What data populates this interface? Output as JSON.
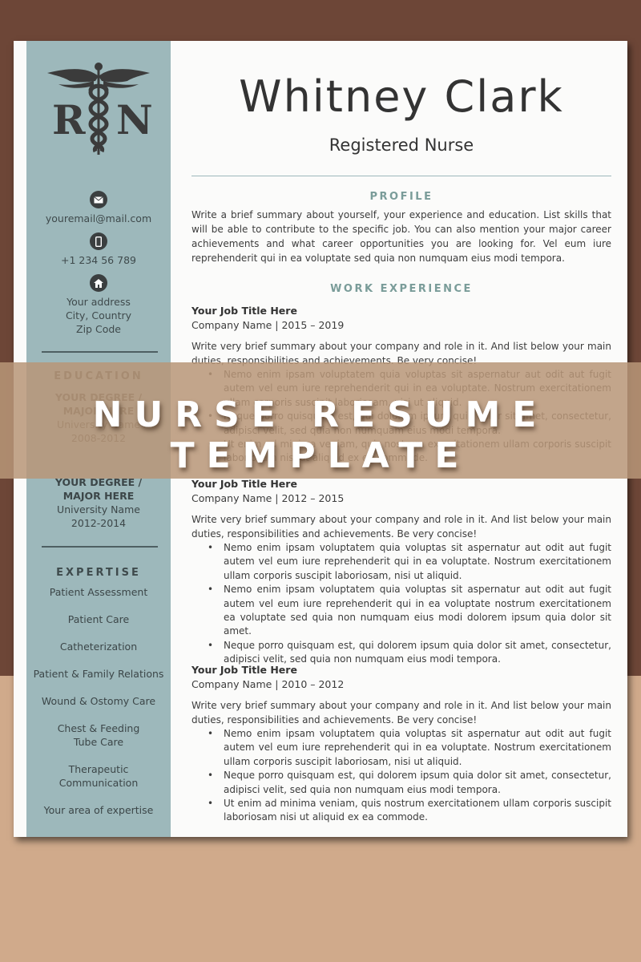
{
  "sidebar": {
    "logo_letters": [
      "R",
      "N"
    ],
    "contact": [
      {
        "icon": "envelope-icon",
        "lines": [
          "youremail@mail.com"
        ]
      },
      {
        "icon": "phone-icon",
        "lines": [
          "+1 234 56 789"
        ]
      },
      {
        "icon": "home-icon",
        "lines": [
          "Your address",
          "City, Country",
          "Zip Code"
        ]
      }
    ],
    "education": {
      "heading": "EDUCATION",
      "items": [
        {
          "degree": [
            "YOUR DEGREE /",
            "MAJOR HERE"
          ],
          "school": "University Name",
          "years": "2008-2012"
        },
        {
          "degree": [
            "YOUR DEGREE /",
            "MAJOR HERE"
          ],
          "school": "University Name",
          "years": "2012-2014"
        }
      ]
    },
    "expertise": {
      "heading": "EXPERTISE",
      "items": [
        "Patient Assessment",
        "Patient Care",
        "Catheterization",
        "Patient & Family Relations",
        "Wound & Ostomy Care",
        "Chest & Feeding Tube Care",
        "Therapeutic Communication",
        "Your area of expertise"
      ]
    }
  },
  "header": {
    "name": "Whitney Clark",
    "role": "Registered Nurse"
  },
  "profile": {
    "heading": "PROFILE",
    "text": "Write a brief summary about yourself, your experience and education. List skills that will be able to contribute to the specific job. You can also mention your major career achievements and what career opportunities you are looking for. Vel eum iure reprehenderit qui in ea voluptate sed quia non numquam eius modi tempora."
  },
  "work": {
    "heading": "WORK EXPERIENCE",
    "jobs": [
      {
        "title": "Your Job Title Here",
        "company": "Company Name | 2015 – 2019",
        "summary": "Write very brief summary about your company and role in it. And list below your main duties, responsibilities and achievements. Be very concise!",
        "bullets": [
          "Nemo enim ipsam voluptatem quia voluptas sit aspernatur aut odit aut fugit autem vel eum iure reprehenderit qui in ea voluptate. Nostrum exercitationem ullam corporis suscipit laboriosam, nisi ut aliquid.",
          "Neque porro quisquam est, qui dolorem ipsum quia dolor sit amet, consectetur, adipisci velit, sed quia non numquam eius modi tempora.",
          "Ut enim ad minima veniam, quis nostrum exercitationem ullam corporis suscipit laboriosam nisi ut aliquid ex ea commode."
        ]
      },
      {
        "title": "Your Job Title Here",
        "company": "Company Name | 2012 – 2015",
        "summary": "Write very brief summary about your company and role in it. And list below your main duties, responsibilities and achievements. Be very concise!",
        "bullets": [
          "Nemo enim ipsam voluptatem quia voluptas sit aspernatur aut odit aut fugit autem vel eum iure reprehenderit qui in ea voluptate. Nostrum exercitationem ullam corporis suscipit laboriosam, nisi ut aliquid.",
          "Nemo enim ipsam voluptatem quia voluptas sit aspernatur aut odit aut fugit autem vel eum iure reprehenderit qui in ea voluptate nostrum exercitationem ea voluptate sed quia non numquam eius modi dolorem ipsum quia dolor sit amet.",
          "Neque porro quisquam est, qui dolorem ipsum quia dolor sit amet, consectetur, adipisci velit, sed quia non numquam eius modi tempora."
        ]
      },
      {
        "title": "Your Job Title Here",
        "company": "Company Name | 2010 – 2012",
        "summary": "Write very brief summary about your company and role in it. And list below your main duties, responsibilities and achievements. Be very concise!",
        "bullets": [
          "Nemo enim ipsam voluptatem quia voluptas sit aspernatur aut odit aut fugit autem vel eum iure reprehenderit qui in ea voluptate. Nostrum exercitationem ullam corporis suscipit laboriosam, nisi ut aliquid.",
          "Neque porro quisquam est, qui dolorem ipsum quia dolor sit amet, consectetur, adipisci velit, sed quia non numquam eius modi tempora.",
          "Ut enim ad minima veniam, quis nostrum exercitationem ullam corporis suscipit laboriosam nisi ut aliquid ex ea commode."
        ]
      }
    ]
  },
  "banner": {
    "text": "NURSE RESUME TEMPLATE"
  },
  "colors": {
    "sidebar": "#9db8bb",
    "accent_heading": "#7a9c99",
    "background_top": "#6d4637",
    "background_bottom": "#d0aa8b",
    "banner_overlay": "#b89678"
  }
}
